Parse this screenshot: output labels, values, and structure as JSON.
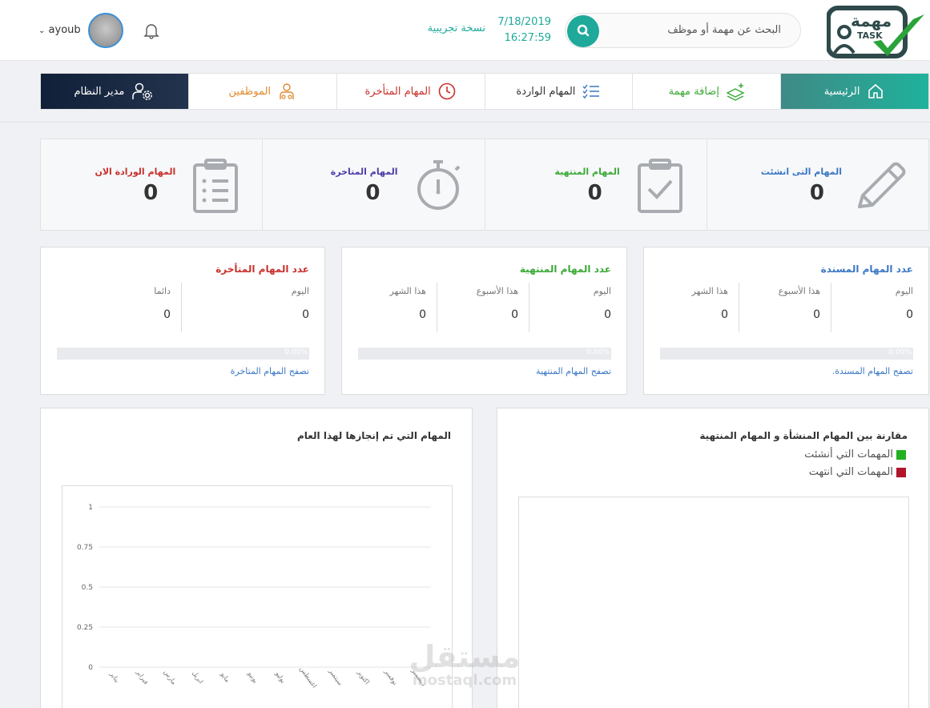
{
  "header": {
    "logo_text_ar": "مهمة",
    "logo_text_en": "TASK",
    "search_placeholder": "البحث عن مهمة أو موظف",
    "date": "7/18/2019",
    "time": "16:27:59",
    "trial_label": "نسخة تجريبية",
    "username": "ayoub"
  },
  "nav": {
    "items": [
      {
        "label": "الرئيسية"
      },
      {
        "label": "إضافة مهمة"
      },
      {
        "label": "المهام الواردة"
      },
      {
        "label": "المهام المتأخرة"
      },
      {
        "label": "الموظفين"
      },
      {
        "label": "مدير النظام"
      }
    ]
  },
  "stats": [
    {
      "label": "المهام التى انشئت",
      "value": "0",
      "color": "#3a77c4"
    },
    {
      "label": "المهام المنتهية",
      "value": "0",
      "color": "#39a935"
    },
    {
      "label": "المهام المتاخرة",
      "value": "0",
      "color": "#4c3aa8"
    },
    {
      "label": "المهام الورادة الان",
      "value": "0",
      "color": "#c9302c"
    }
  ],
  "cards": [
    {
      "title": "عدد المهام المسندة",
      "color": "#3a77c4",
      "cols": [
        {
          "h": "اليوم",
          "v": "0"
        },
        {
          "h": "هذا الأسبوع",
          "v": "0"
        },
        {
          "h": "هذا الشهر",
          "v": "0"
        }
      ],
      "progress": "0.00%",
      "progress_value": 0,
      "link": "تصفح المهام المسندة."
    },
    {
      "title": "عدد المهام المنتهية",
      "color": "#39a935",
      "cols": [
        {
          "h": "اليوم",
          "v": "0"
        },
        {
          "h": "هذا الأسبوع",
          "v": "0"
        },
        {
          "h": "هذا الشهر",
          "v": "0"
        }
      ],
      "progress": "0.00%",
      "progress_value": 0,
      "link": "تصفح المهام المنتهية"
    },
    {
      "title": "عدد المهام المتأخرة",
      "color": "#c9302c",
      "cols": [
        {
          "h": "اليوم",
          "v": "0"
        },
        {
          "h": "دائما",
          "v": "0"
        }
      ],
      "progress": "0.00%",
      "progress_value": 0,
      "link": "تصفح المهام المتاخرة"
    }
  ],
  "compare_panel": {
    "title": "مقارنة بين المهام المنشأة و المهام المنتهية",
    "legend": [
      {
        "label": "المهمات التي أنشئت",
        "color": "#22b022"
      },
      {
        "label": "المهمات التي انتهت",
        "color": "#b0152a"
      }
    ]
  },
  "year_panel": {
    "title": "المهام التي تم إنجازها لهذا العام"
  },
  "chart_data": {
    "type": "line",
    "title": "المهام التي تم إنجازها لهذا العام",
    "categories": [
      "يناير",
      "فبراير",
      "مارس",
      "ابريل",
      "مايو",
      "يونيو",
      "يوليو",
      "اغسطس",
      "سبتمبر",
      "اكتوبر",
      "نوفمبر",
      "ديسمبر"
    ],
    "yticks": [
      "0",
      "0.25",
      "0.5",
      "0.75",
      "1"
    ],
    "ylim": [
      0,
      1
    ],
    "grid": true
  },
  "watermark": {
    "line1": "مستقل",
    "line2": "mostaql.com"
  }
}
